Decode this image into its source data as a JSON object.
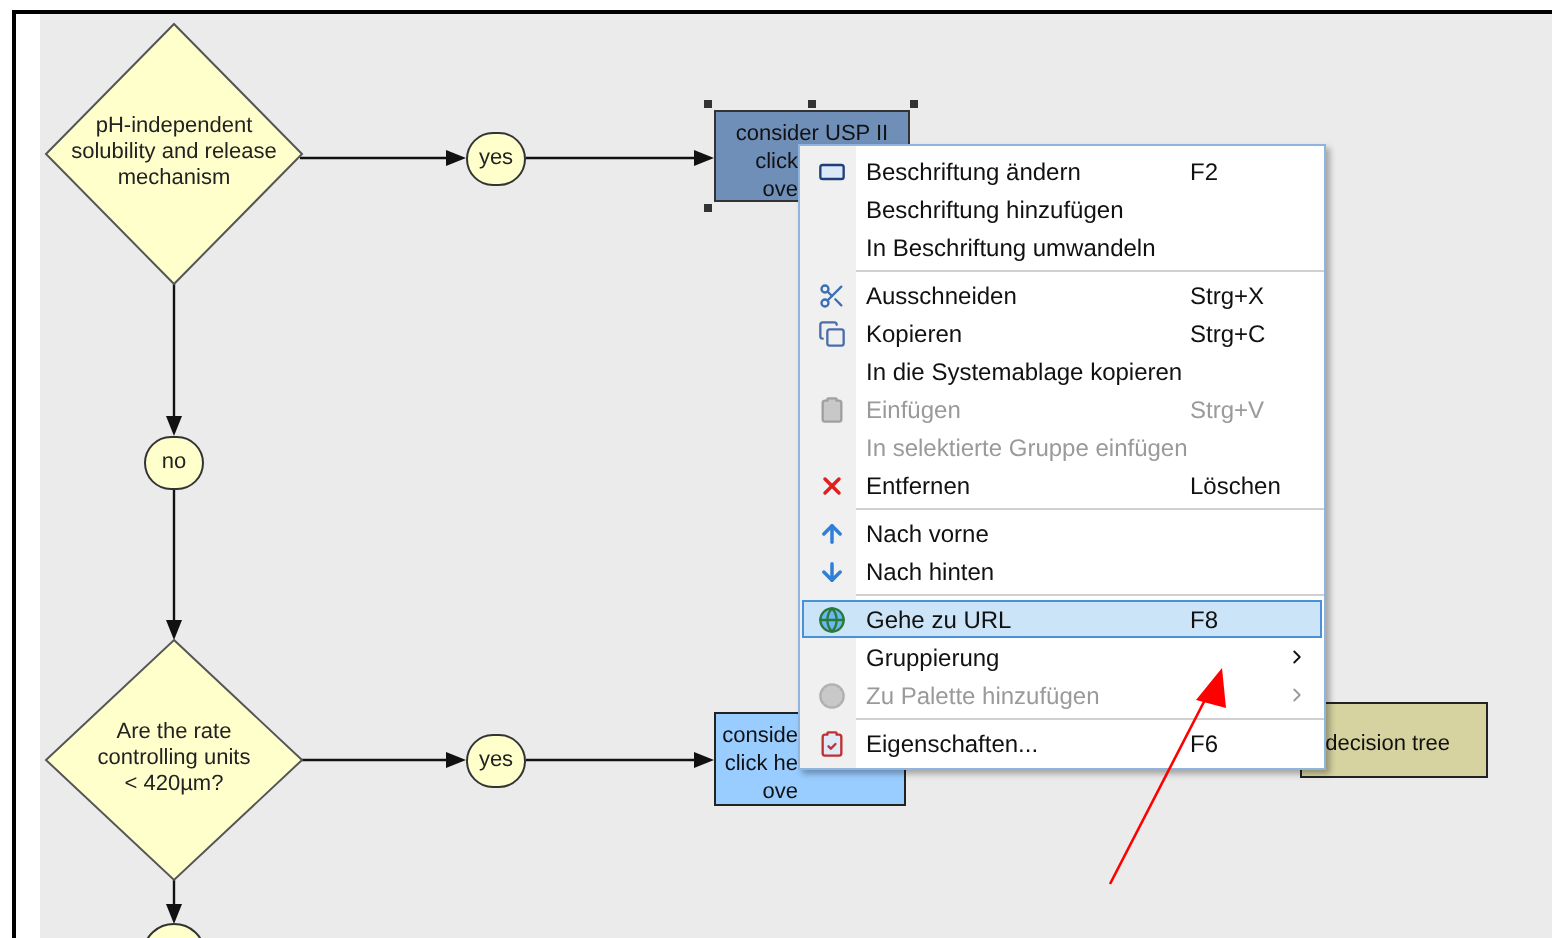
{
  "diagram": {
    "decisions": [
      {
        "lines": [
          "pH-independent",
          "solubility and release",
          "mechanism"
        ]
      },
      {
        "lines": [
          "Are the rate",
          "controlling units",
          "< 420µm?"
        ]
      }
    ],
    "branch_labels": [
      "yes",
      "no",
      "yes"
    ],
    "boxes": [
      {
        "lines": [
          "consider USP II",
          "click",
          "ove"
        ],
        "selected": true,
        "color": "#6f8fb8"
      },
      {
        "lines": [
          "conside",
          "click he",
          "ove"
        ],
        "selected": false,
        "color": "#99ccff"
      },
      {
        "lines": [
          "decision tree"
        ],
        "selected": false,
        "color": "#d6d3a0"
      }
    ]
  },
  "context_menu": {
    "groups": [
      [
        {
          "label": "Beschriftung ändern",
          "shortcut": "F2",
          "disabled": false,
          "selected": false,
          "submenu": false
        },
        {
          "label": "Beschriftung hinzufügen",
          "disabled": false,
          "selected": false,
          "submenu": false
        },
        {
          "label": "In Beschriftung umwandeln",
          "disabled": false,
          "selected": false,
          "submenu": false
        }
      ],
      [
        {
          "label": "Ausschneiden",
          "shortcut": "Strg+X",
          "disabled": false,
          "selected": false,
          "submenu": false
        },
        {
          "label": "Kopieren",
          "shortcut": "Strg+C",
          "disabled": false,
          "selected": false,
          "submenu": false
        },
        {
          "label": "In die Systemablage kopieren",
          "disabled": false,
          "selected": false,
          "submenu": false
        },
        {
          "label": "Einfügen",
          "shortcut": "Strg+V",
          "disabled": true,
          "selected": false,
          "submenu": false
        },
        {
          "label": "In selektierte Gruppe einfügen",
          "disabled": true,
          "selected": false,
          "submenu": false
        },
        {
          "label": "Entfernen",
          "shortcut": "Löschen",
          "disabled": false,
          "selected": false,
          "submenu": false
        }
      ],
      [
        {
          "label": "Nach vorne",
          "disabled": false,
          "selected": false,
          "submenu": false
        },
        {
          "label": "Nach hinten",
          "disabled": false,
          "selected": false,
          "submenu": false
        }
      ],
      [
        {
          "label": "Gehe zu URL",
          "shortcut": "F8",
          "disabled": false,
          "selected": true,
          "submenu": false
        },
        {
          "label": "Gruppierung",
          "disabled": false,
          "selected": false,
          "submenu": true
        },
        {
          "label": "Zu Palette hinzufügen",
          "disabled": true,
          "selected": false,
          "submenu": true
        }
      ],
      [
        {
          "label": "Eigenschaften...",
          "shortcut": "F6",
          "disabled": false,
          "selected": false,
          "submenu": false
        }
      ]
    ]
  }
}
